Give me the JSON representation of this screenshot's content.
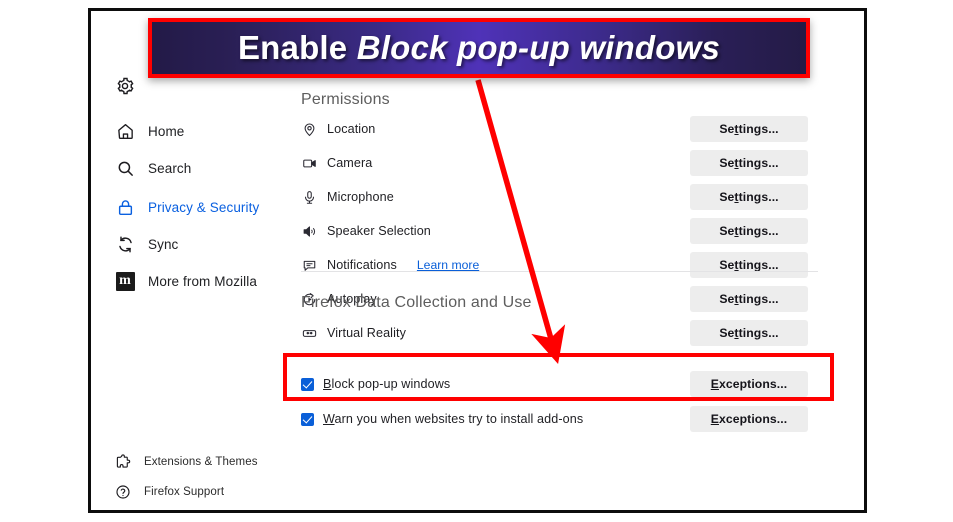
{
  "callout": {
    "prefix": "Enable ",
    "emphasis": "Block pop-up windows",
    "border_color": "#ff0000",
    "gradient_from": "#231a47",
    "gradient_to": "#4f32b8"
  },
  "sidebar": {
    "gear_icon": "gear-icon",
    "items": [
      {
        "label": "Home",
        "icon": "home-icon",
        "active": false
      },
      {
        "label": "Search",
        "icon": "search-icon",
        "active": false
      },
      {
        "label": "Privacy & Security",
        "icon": "lock-icon",
        "active": true
      },
      {
        "label": "Sync",
        "icon": "sync-icon",
        "active": false
      },
      {
        "label": "More from Mozilla",
        "icon": "mozilla-m-icon",
        "active": false
      }
    ],
    "footer_items": [
      {
        "label": "Extensions & Themes",
        "icon": "puzzle-piece-icon"
      },
      {
        "label": "Firefox Support",
        "icon": "question-circle-icon"
      }
    ],
    "active_color": "#0a60e0"
  },
  "main": {
    "permissions_heading": "Permissions",
    "data_heading": "Firefox Data Collection and Use",
    "settings_button_label": "Settings...",
    "settings_button_accesskey": "t",
    "exceptions_button_label": "Exceptions...",
    "exceptions_button_accesskey": "E",
    "learn_more_label": "Learn more",
    "permissions": [
      {
        "label": "Location",
        "icon": "location-pin-icon",
        "button": "Settings...",
        "link": null
      },
      {
        "label": "Camera",
        "icon": "camera-icon",
        "button": "Settings...",
        "link": null
      },
      {
        "label": "Microphone",
        "icon": "microphone-icon",
        "button": "Settings...",
        "link": null
      },
      {
        "label": "Speaker Selection",
        "icon": "speaker-icon",
        "button": "Settings...",
        "link": null
      },
      {
        "label": "Notifications",
        "icon": "notification-icon",
        "button": "Settings...",
        "link": "Learn more"
      },
      {
        "label": "Autoplay",
        "icon": "autoplay-icon",
        "button": "Settings...",
        "link": null
      },
      {
        "label": "Virtual Reality",
        "icon": "vr-headset-icon",
        "button": "Settings...",
        "link": null
      }
    ],
    "checkboxes": [
      {
        "accesskey": "B",
        "label_rest": "lock pop-up windows",
        "checked": true,
        "button": "Exceptions...",
        "highlighted": true
      },
      {
        "accesskey": "W",
        "label_rest": "arn you when websites try to install add-ons",
        "checked": true,
        "button": "Exceptions...",
        "highlighted": false
      }
    ],
    "checkbox_color": "#0a5fd8"
  }
}
